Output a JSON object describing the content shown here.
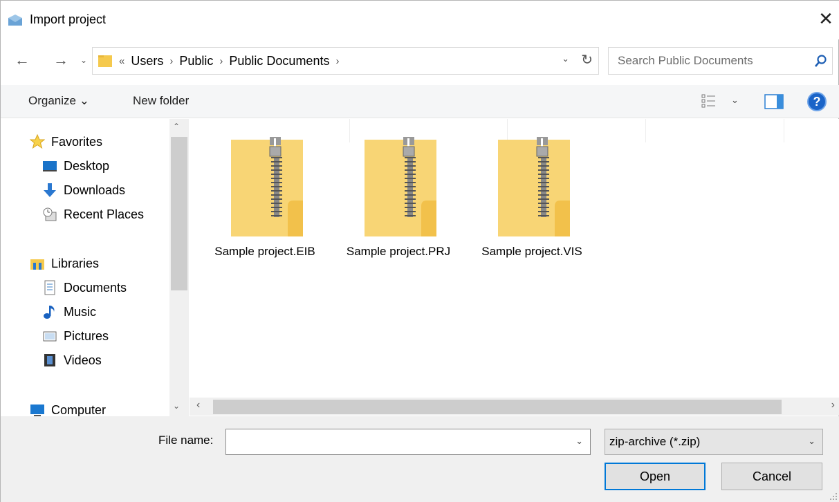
{
  "window": {
    "title": "Import project",
    "close_glyph": "✕"
  },
  "nav": {
    "back_glyph": "←",
    "forward_glyph": "→",
    "recent_glyph": "⌄",
    "address": {
      "overflow_glyph": "«",
      "separator_glyph": "›",
      "crumbs": [
        "Users",
        "Public",
        "Public Documents"
      ],
      "dropdown_glyph": "⌄",
      "refresh_glyph": "↻"
    },
    "search": {
      "placeholder": "Search Public Documents",
      "value": ""
    }
  },
  "toolbar": {
    "organize_label": "Organize ⌄",
    "new_folder_label": "New folder",
    "views_chevron": "⌄",
    "help_glyph": "?"
  },
  "sidebar": {
    "items": [
      {
        "label": "Favorites",
        "icon": "star-icon"
      },
      {
        "label": "Desktop",
        "icon": "desktop-icon"
      },
      {
        "label": "Downloads",
        "icon": "download-arrow-icon"
      },
      {
        "label": "Recent Places",
        "icon": "recent-places-icon"
      },
      {
        "label": "Libraries",
        "icon": "libraries-icon"
      },
      {
        "label": "Documents",
        "icon": "documents-icon"
      },
      {
        "label": "Music",
        "icon": "music-note-icon"
      },
      {
        "label": "Pictures",
        "icon": "pictures-icon"
      },
      {
        "label": "Videos",
        "icon": "videos-icon"
      },
      {
        "label": "Computer",
        "icon": "computer-icon"
      }
    ],
    "scroll_up_glyph": "⌃",
    "scroll_down_glyph": "⌄"
  },
  "files": [
    {
      "name": "Sample project.EIB",
      "icon": "zip-folder-icon"
    },
    {
      "name": "Sample project.PRJ",
      "icon": "zip-folder-icon"
    },
    {
      "name": "Sample project.VIS",
      "icon": "zip-folder-icon"
    }
  ],
  "hscroll": {
    "left_glyph": "‹",
    "right_glyph": "›"
  },
  "footer": {
    "file_name_label": "File name:",
    "file_name_value": "",
    "file_name_dropdown_glyph": "⌄",
    "file_type_value": "zip-archive (*.zip)",
    "file_type_dropdown_glyph": "⌄",
    "open_label": "Open",
    "cancel_label": "Cancel"
  },
  "colors": {
    "folder": "#f5c94d",
    "folder_light": "#fbdc7e",
    "accent": "#0078d7",
    "help": "#1a64c8"
  }
}
